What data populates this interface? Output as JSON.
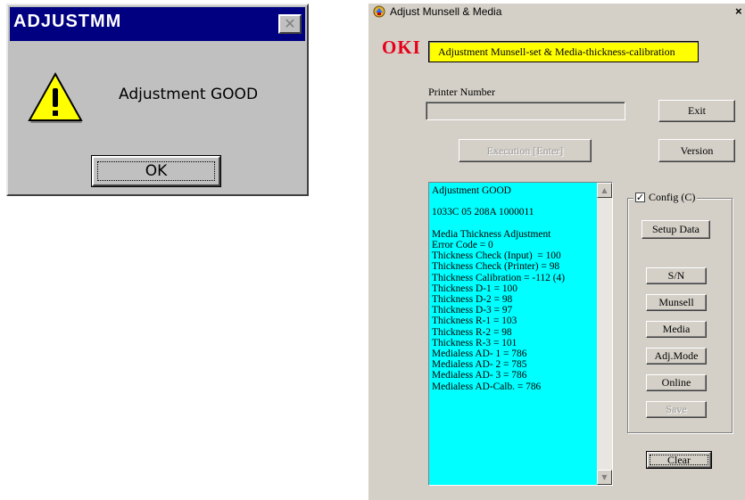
{
  "message_box": {
    "title": "ADJUSTMM",
    "close_symbol": "✕",
    "icon": "warning-icon",
    "message": "Adjustment GOOD",
    "ok_label": "OK"
  },
  "app": {
    "title": "Adjust Munsell & Media",
    "close_symbol": "×",
    "logo": "OKI",
    "headline": "Adjustment Munsell-set & Media-thickness-calibration",
    "printer_number": {
      "label": "Printer Number",
      "value": ""
    },
    "buttons": {
      "exit": "Exit",
      "version": "Version",
      "execution": "Execution [Enter]",
      "setup_data": "Setup Data",
      "sn": "S/N",
      "munsell": "Munsell",
      "media": "Media",
      "adj_mode": "Adj.Mode",
      "online": "Online",
      "save": "Save",
      "clear": "Clear"
    },
    "config": {
      "label": "Config (C)",
      "checked": true
    },
    "output_lines": [
      "Adjustment GOOD",
      "",
      "1033C 05 208A 1000011",
      "",
      "Media Thickness Adjustment",
      "Error Code = 0",
      "Thickness Check (Input)  = 100",
      "Thickness Check (Printer) = 98",
      "Thickness Calibration = -112 (4)",
      "Thickness D-1 = 100",
      "Thickness D-2 = 98",
      "Thickness D-3 = 97",
      "Thickness R-1 = 103",
      "Thickness R-2 = 98",
      "Thickness R-3 = 101",
      "Medialess AD- 1 = 786",
      "Medialess AD- 2 = 785",
      "Medialess AD- 3 = 786",
      "Medialess AD-Calb. = 786"
    ]
  },
  "colors": {
    "titlebar": "#000080",
    "output_bg": "#00ffff",
    "headline_bg": "#ffff00",
    "logo": "#e8001a",
    "window_bg": "#d4d0c8"
  }
}
